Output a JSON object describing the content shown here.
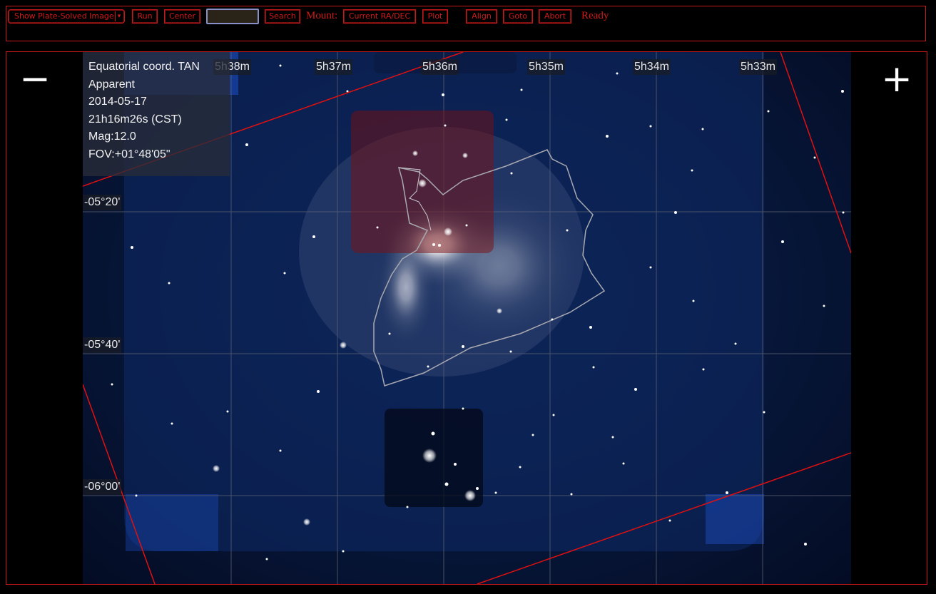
{
  "toolbar": {
    "image_select": "Show Plate-Solved Image",
    "run_button": "Run",
    "center_button": "Center",
    "search_input_value": "",
    "search_button": "Search",
    "mount_label": "Mount:",
    "current_radec_button": "Current RA/DEC",
    "plot_button": "Plot",
    "align_button": "Align",
    "goto_button": "Goto",
    "abort_button": "Abort",
    "status": "Ready"
  },
  "view": {
    "zoom_out": "−",
    "zoom_in": "+",
    "info": {
      "projection": "Equatorial coord. TAN",
      "mode": "Apparent",
      "date": "2014-05-17",
      "time": "21h16m26s (CST)",
      "magnitude": "Mag:12.0",
      "fov": "FOV:+01°48'05\""
    },
    "ra_labels": [
      "5h38m",
      "5h37m",
      "5h36m",
      "5h35m",
      "5h34m",
      "5h33m"
    ],
    "dec_labels": [
      "-05°20'",
      "-05°40'",
      "-06°00'"
    ]
  },
  "colors": {
    "ui_red": "#d01a1a",
    "sky_blue": "#0b1f4a",
    "grid_gray": "#5a6070",
    "fov_line_red": "#e01010"
  }
}
